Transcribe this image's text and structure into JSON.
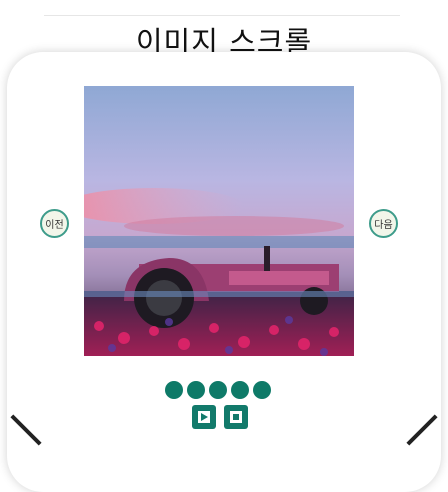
{
  "header": {
    "title": "이미지 스크롤"
  },
  "carousel": {
    "prev_label": "이전",
    "next_label": "다음",
    "image_icon": "tractor-sunset-photo",
    "dot_count": 5,
    "active_color": "#0e7a68"
  },
  "controls": {
    "play_icon": "play-icon",
    "stop_icon": "stop-icon"
  }
}
